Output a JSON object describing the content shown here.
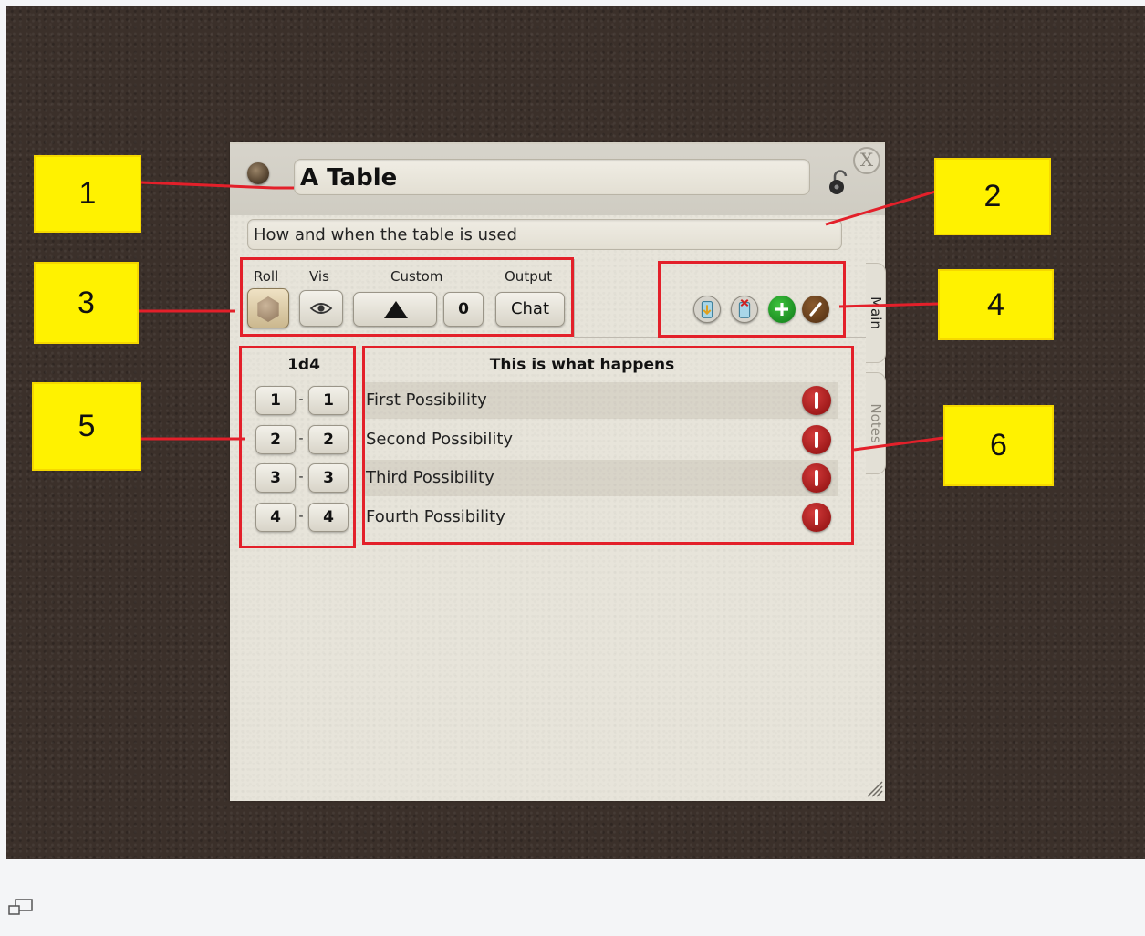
{
  "window": {
    "title": "A Table",
    "description": "How and when the table is used",
    "close_glyph": "X",
    "icons": {
      "link": "link-icon",
      "lock": "lock-icon",
      "close": "close-icon"
    }
  },
  "controls": {
    "roll_label": "Roll",
    "vis_label": "Vis",
    "custom_label": "Custom",
    "output_label": "Output",
    "custom_count": "0",
    "output_value": "Chat",
    "icons": [
      "die-icon",
      "eye-icon",
      "triangle-icon"
    ]
  },
  "toolbar": {
    "icons": [
      "export-icon",
      "delete-all-icon",
      "add-icon",
      "edit-icon"
    ]
  },
  "tabs": [
    "Main",
    "Notes"
  ],
  "table": {
    "dice": "1d4",
    "result_header": "This is what happens",
    "rows": [
      {
        "from": "1",
        "to": "1",
        "result": "First Possibility"
      },
      {
        "from": "2",
        "to": "2",
        "result": "Second Possibility"
      },
      {
        "from": "3",
        "to": "3",
        "result": "Third Possibility"
      },
      {
        "from": "4",
        "to": "4",
        "result": "Fourth Possibility"
      }
    ]
  },
  "annotations": [
    "1",
    "2",
    "3",
    "4",
    "5",
    "6"
  ],
  "colors": {
    "annotation_fill": "#fff200",
    "annotation_border": "#e3202a",
    "delete_button": "#b01818",
    "add_button": "#1f9a2a",
    "edit_button": "#6b4220",
    "background": "#3b302a",
    "panel": "#e7e4da"
  }
}
